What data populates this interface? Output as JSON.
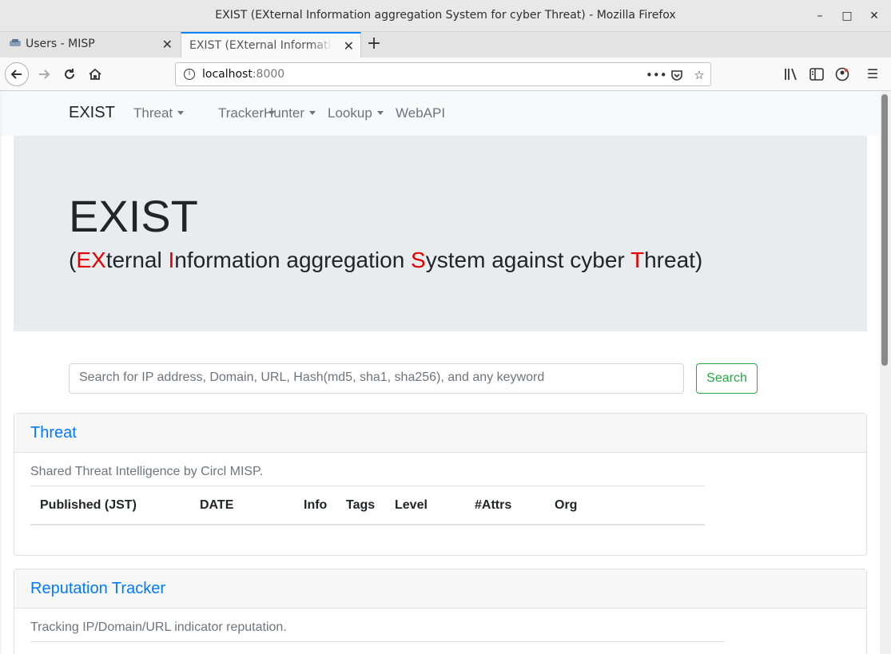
{
  "window": {
    "title": "EXIST (EXternal Information aggregation System for cyber Threat) - Mozilla Firefox",
    "minimize": "–",
    "maximize": "□",
    "close": "✕"
  },
  "tabs": [
    {
      "label": "Users - MISP",
      "active": false
    },
    {
      "label": "EXIST (EXternal Information aggregation System for cyber Threat)",
      "active": true
    }
  ],
  "new_tab": "+",
  "url": {
    "host": "localhost",
    "port": ":8000"
  },
  "site": {
    "brand": "EXIST",
    "nav": [
      {
        "label": "Threat",
        "dropdown": true
      },
      {
        "label": "Tracker",
        "dropdown": true
      },
      {
        "label": "Hunter",
        "dropdown": true
      },
      {
        "label": "Lookup",
        "dropdown": true
      },
      {
        "label": "WebAPI",
        "dropdown": false
      }
    ]
  },
  "jumbotron": {
    "title": "EXIST",
    "subtitle_parts": [
      {
        "text": "(",
        "red": false
      },
      {
        "text": "EX",
        "red": true
      },
      {
        "text": "ternal ",
        "red": false
      },
      {
        "text": "I",
        "red": true
      },
      {
        "text": "nformation aggregation ",
        "red": false
      },
      {
        "text": "S",
        "red": true
      },
      {
        "text": "ystem against cyber ",
        "red": false
      },
      {
        "text": "T",
        "red": true
      },
      {
        "text": "hreat)",
        "red": false
      }
    ]
  },
  "search": {
    "placeholder": "Search for IP address, Domain, URL, Hash(md5, sha1, sha256), and any keyword",
    "button": "Search"
  },
  "threat_card": {
    "title": "Threat",
    "text": "Shared Threat Intelligence by Circl MISP.",
    "columns": [
      "Published (JST)",
      "DATE",
      "Info",
      "Tags",
      "Level",
      "#Attrs",
      "Org"
    ]
  },
  "reputation_card": {
    "title": "Reputation Tracker",
    "text": "Tracking IP/Domain/URL indicator reputation."
  },
  "colors": {
    "accent": "#007bff",
    "success": "#28a745",
    "highlight": "#e00000"
  }
}
